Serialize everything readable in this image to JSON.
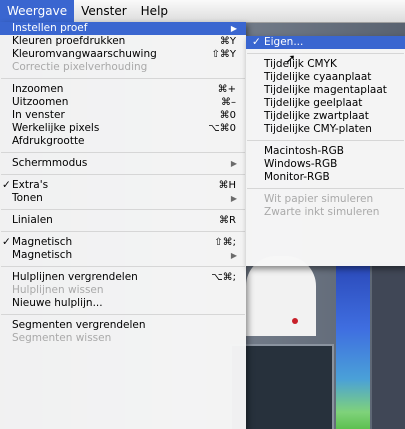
{
  "menubar": [
    "Weergave",
    "Venster",
    "Help"
  ],
  "menu": [
    {
      "label": "Instellen proef",
      "arrow": true,
      "selected": true
    },
    {
      "label": "Kleuren proefdrukken",
      "shortcut": "⌘Y"
    },
    {
      "label": "Kleuromvangwaarschuwing",
      "shortcut": "⇧⌘Y"
    },
    {
      "label": "Correctie pixelverhouding",
      "disabled": true
    },
    {
      "sep": true
    },
    {
      "label": "Inzoomen",
      "shortcut": "⌘+"
    },
    {
      "label": "Uitzoomen",
      "shortcut": "⌘–"
    },
    {
      "label": "In venster",
      "shortcut": "⌘0"
    },
    {
      "label": "Werkelijke pixels",
      "shortcut": "⌥⌘0"
    },
    {
      "label": "Afdrukgrootte"
    },
    {
      "sep": true
    },
    {
      "label": "Schermmodus",
      "arrow": true
    },
    {
      "sep": true
    },
    {
      "label": "Extra's",
      "shortcut": "⌘H",
      "checked": true
    },
    {
      "label": "Tonen",
      "arrow": true
    },
    {
      "sep": true
    },
    {
      "label": "Linialen",
      "shortcut": "⌘R"
    },
    {
      "sep": true
    },
    {
      "label": "Magnetisch",
      "shortcut": "⇧⌘;",
      "checked": true
    },
    {
      "label": "Magnetisch",
      "arrow": true
    },
    {
      "sep": true
    },
    {
      "label": "Hulplijnen vergrendelen",
      "shortcut": "⌥⌘;"
    },
    {
      "label": "Hulplijnen wissen",
      "disabled": true
    },
    {
      "label": "Nieuwe hulplijn..."
    },
    {
      "sep": true
    },
    {
      "label": "Segmenten vergrendelen"
    },
    {
      "label": "Segmenten wissen",
      "disabled": true
    }
  ],
  "submenu": [
    {
      "label": "Eigen...",
      "checked": true,
      "selected": true
    },
    {
      "sep": true
    },
    {
      "label": "Tijdelijk CMYK"
    },
    {
      "label": "Tijdelijke cyaanplaat"
    },
    {
      "label": "Tijdelijke magentaplaat"
    },
    {
      "label": "Tijdelijke geelplaat"
    },
    {
      "label": "Tijdelijke zwartplaat"
    },
    {
      "label": "Tijdelijke CMY-platen"
    },
    {
      "sep": true
    },
    {
      "label": "Macintosh-RGB"
    },
    {
      "label": "Windows-RGB"
    },
    {
      "label": "Monitor-RGB"
    },
    {
      "sep": true
    },
    {
      "label": "Wit papier simuleren",
      "disabled": true
    },
    {
      "label": "Zwarte inkt simuleren",
      "disabled": true
    }
  ],
  "colors": {
    "accent": "#3a66d0",
    "disabled": "#a9a9a9"
  }
}
